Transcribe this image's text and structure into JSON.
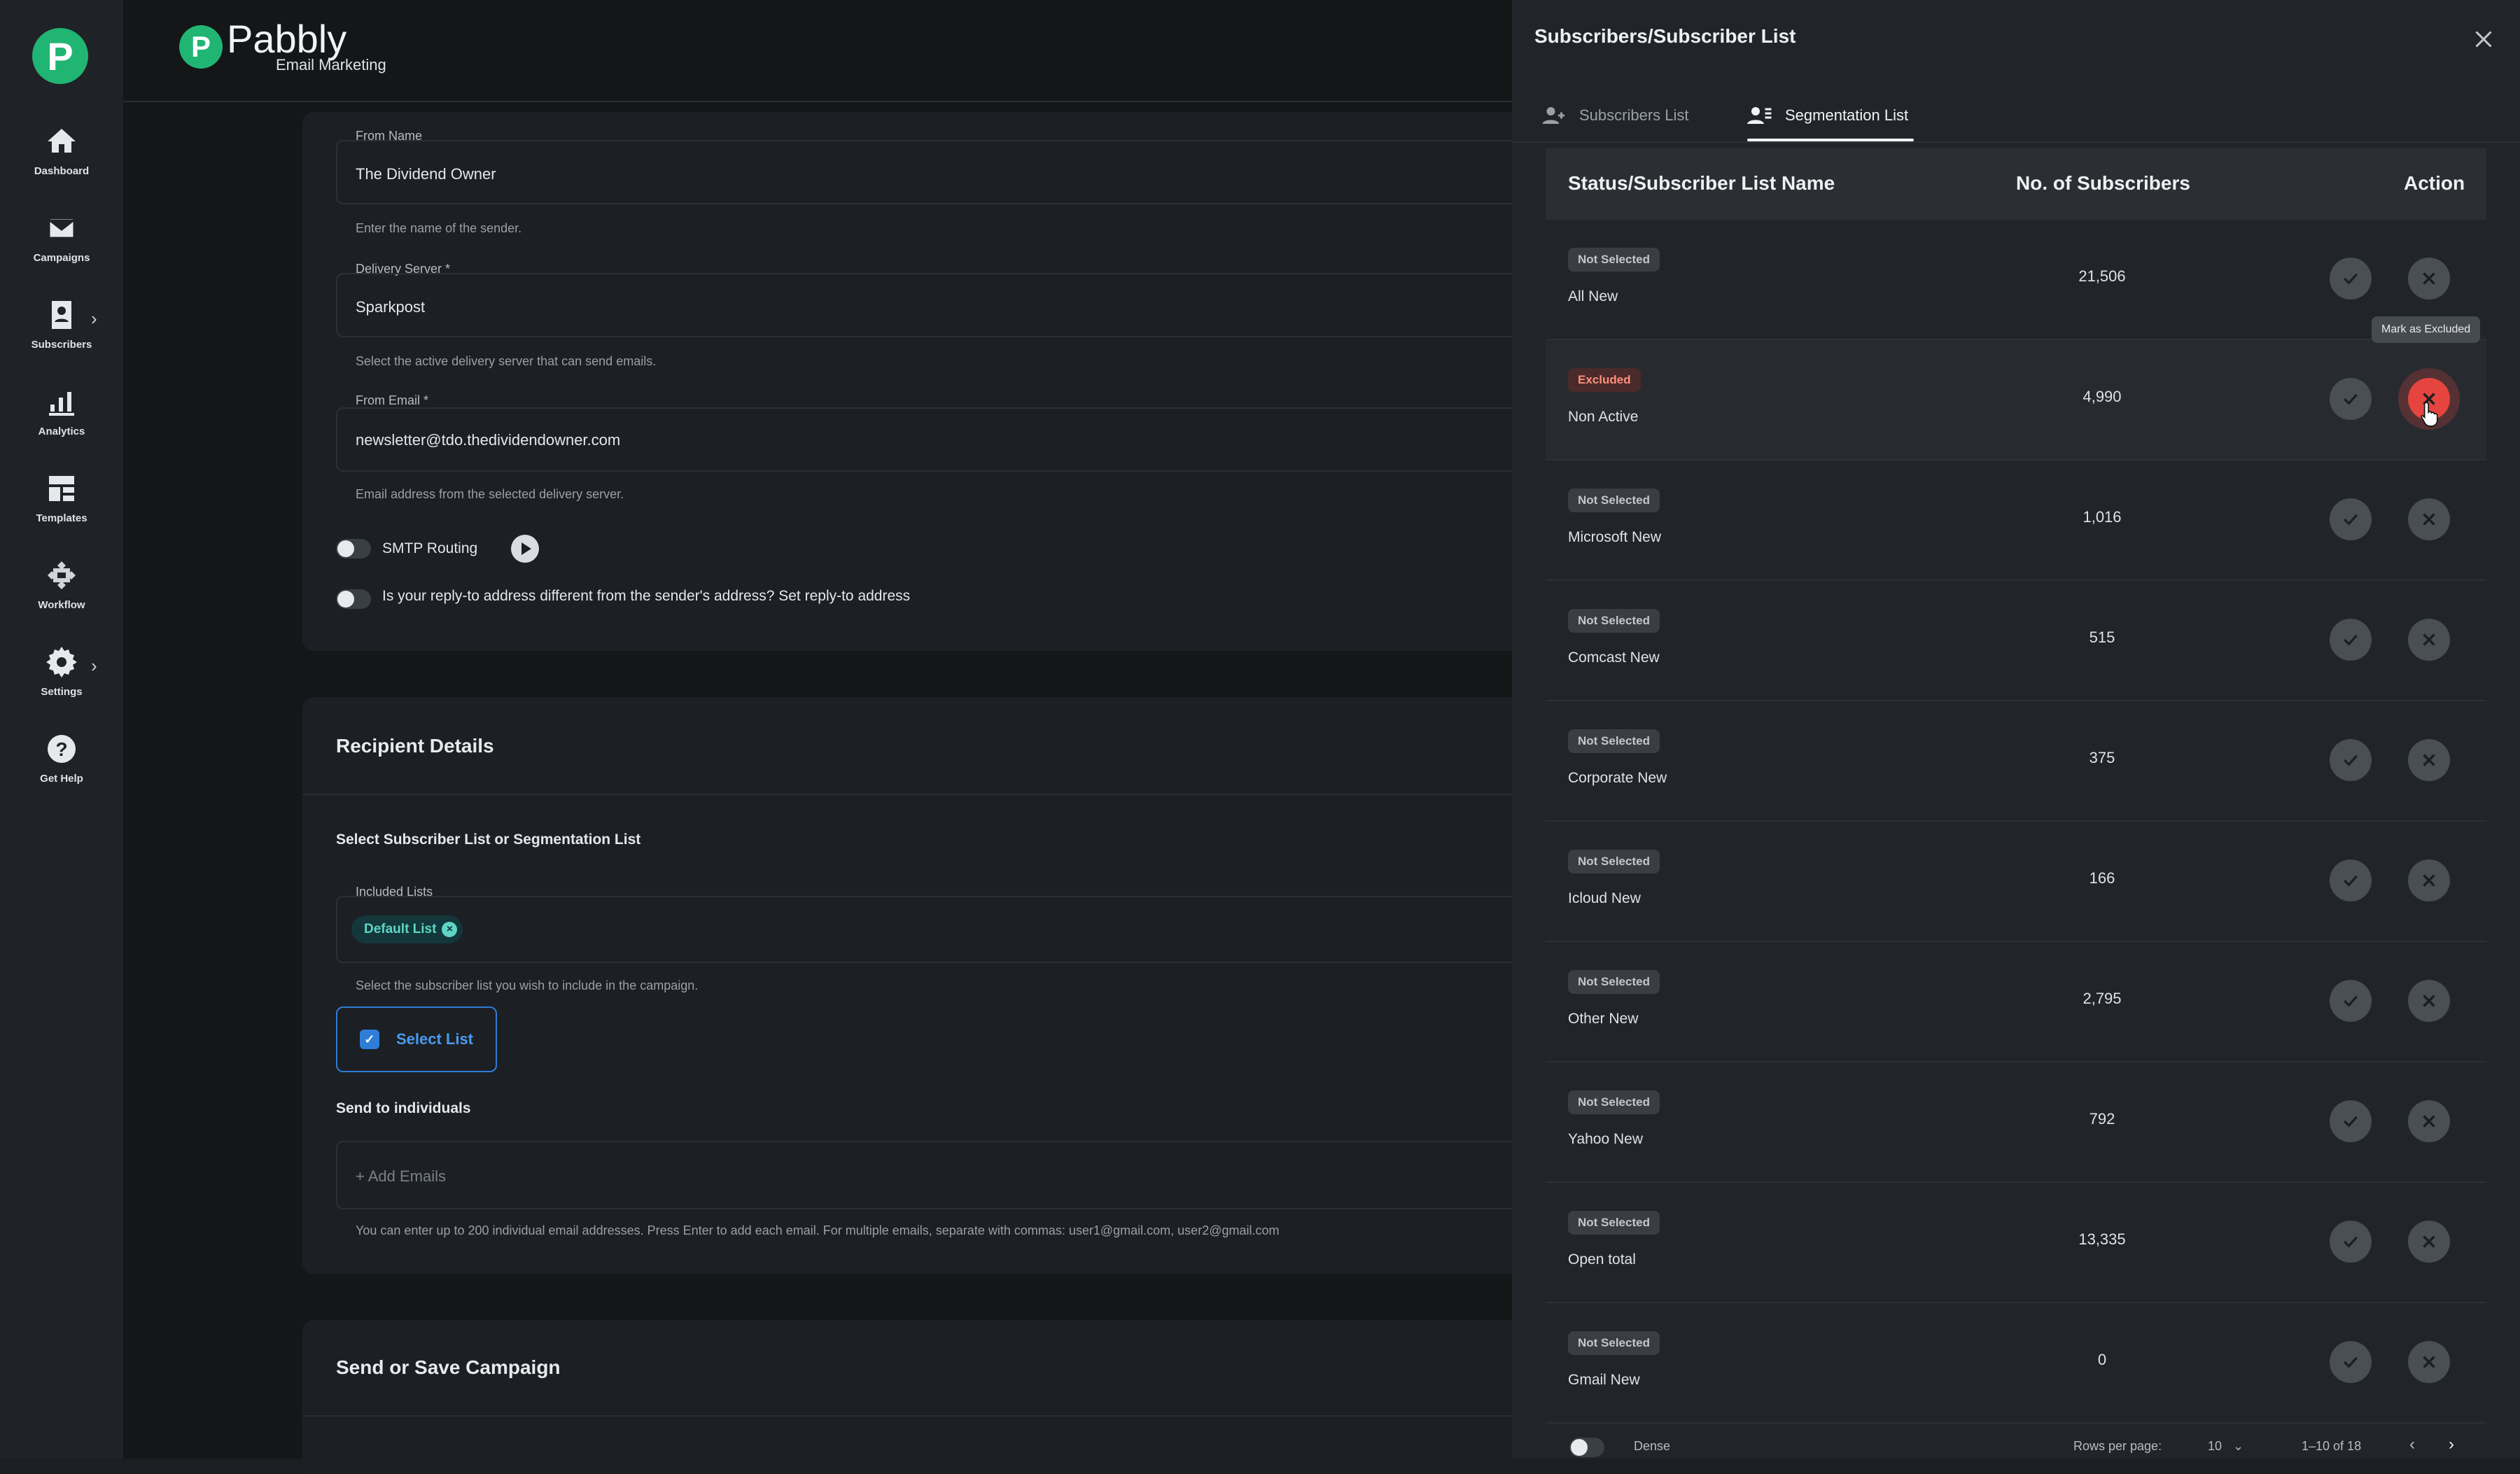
{
  "sidebar": {
    "logo": "P",
    "items": [
      {
        "label": "Dashboard",
        "icon": "home-icon"
      },
      {
        "label": "Campaigns",
        "icon": "mail-icon"
      },
      {
        "label": "Subscribers",
        "icon": "contact-icon"
      },
      {
        "label": "Analytics",
        "icon": "analytics-icon"
      },
      {
        "label": "Templates",
        "icon": "templates-icon"
      },
      {
        "label": "Workflow",
        "icon": "workflow-icon"
      },
      {
        "label": "Settings",
        "icon": "gear-icon"
      },
      {
        "label": "Get Help",
        "icon": "help-icon"
      }
    ]
  },
  "brand": {
    "letter": "P",
    "name": "Pabbly",
    "sub": "Email Marketing"
  },
  "form": {
    "from_name_label": "From Name",
    "from_name_value": "The Dividend Owner",
    "from_name_help": "Enter the name of the sender.",
    "delivery_label": "Delivery Server *",
    "delivery_value": "Sparkpost",
    "delivery_help": "Select the active delivery server that can send emails.",
    "from_email_label": "From Email *",
    "from_email_value": "newsletter@tdo.thedividendowner.com",
    "from_email_help": "Email address from the selected delivery server.",
    "smtp_label": "SMTP Routing",
    "reply_label": "Is your reply-to address different from the sender's address? Set reply-to address"
  },
  "recipient": {
    "title": "Recipient Details",
    "select_heading": "Select Subscriber List or Segmentation List",
    "included_label": "Included Lists",
    "chip": "Default List",
    "included_help": "Select the subscriber list you wish to include in the campaign.",
    "select_btn": "Select List",
    "individuals_heading": "Send to individuals",
    "add_emails_placeholder": "+ Add Emails",
    "individuals_help": "You can enter up to 200 individual email addresses. Press Enter to add each email. For multiple emails, separate with commas: user1@gmail.com, user2@gmail.com"
  },
  "send_section": {
    "title": "Send or Save Campaign"
  },
  "drawer": {
    "title": "Subscribers/Subscriber List",
    "tabs": [
      "Subscribers List",
      "Segmentation List"
    ],
    "headers": {
      "name": "Status/Subscriber List Name",
      "count": "No. of Subscribers",
      "action": "Action"
    },
    "tooltip": "Mark as Excluded",
    "rows": [
      {
        "status": "Not Selected",
        "name": "All New",
        "count": "21,506"
      },
      {
        "status": "Excluded",
        "name": "Non Active",
        "count": "4,990"
      },
      {
        "status": "Not Selected",
        "name": "Microsoft New",
        "count": "1,016"
      },
      {
        "status": "Not Selected",
        "name": "Comcast New",
        "count": "515"
      },
      {
        "status": "Not Selected",
        "name": "Corporate New",
        "count": "375"
      },
      {
        "status": "Not Selected",
        "name": "Icloud New",
        "count": "166"
      },
      {
        "status": "Not Selected",
        "name": "Other New",
        "count": "2,795"
      },
      {
        "status": "Not Selected",
        "name": "Yahoo New",
        "count": "792"
      },
      {
        "status": "Not Selected",
        "name": "Open total",
        "count": "13,335"
      },
      {
        "status": "Not Selected",
        "name": "Gmail New",
        "count": "0"
      }
    ],
    "footer": {
      "dense": "Dense",
      "rows_per_page": "Rows per page:",
      "rows_value": "10",
      "range": "1–10 of 18"
    }
  },
  "colors": {
    "accent": "#21b573",
    "danger": "#e5453e",
    "link": "#2e7dd7"
  }
}
